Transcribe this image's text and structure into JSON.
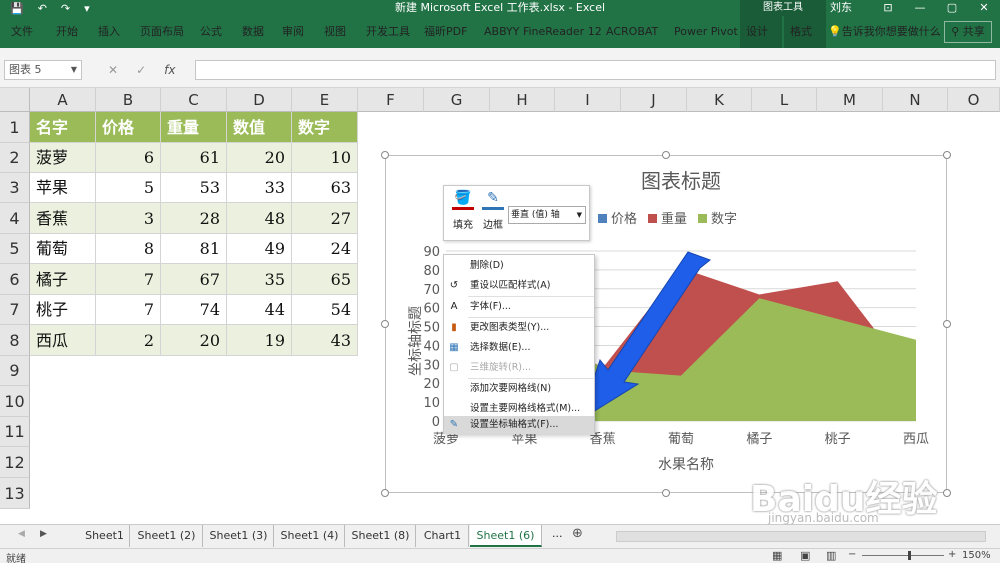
{
  "window": {
    "title": "新建 Microsoft Excel 工作表.xlsx  -  Excel",
    "context_group": "图表工具",
    "user": "刘东",
    "controls": [
      "—",
      "▢",
      "✕"
    ]
  },
  "ribbon": {
    "tabs": [
      "文件",
      "开始",
      "插入",
      "页面布局",
      "公式",
      "数据",
      "审阅",
      "视图",
      "开发工具",
      "福昕PDF",
      "ABBYY FineReader 12",
      "ACROBAT",
      "Power Pivot",
      "设计",
      "格式"
    ],
    "tell_me": "告诉我你想要做什么",
    "share": "共享"
  },
  "formula_bar": {
    "name_box": "图表 5",
    "cancel": "✕",
    "enter": "✓",
    "fx": "fx",
    "value": ""
  },
  "columns": [
    "A",
    "B",
    "C",
    "D",
    "E",
    "F",
    "G",
    "H",
    "I",
    "J",
    "K",
    "L",
    "M",
    "N",
    "O"
  ],
  "rows": [
    "1",
    "2",
    "3",
    "4",
    "5",
    "6",
    "7",
    "8",
    "9",
    "10",
    "11",
    "12",
    "13"
  ],
  "table": {
    "headers": [
      "名字",
      "价格",
      "重量",
      "数值",
      "数字"
    ],
    "rows": [
      [
        "菠萝",
        "6",
        "61",
        "20",
        "10"
      ],
      [
        "苹果",
        "5",
        "53",
        "33",
        "63"
      ],
      [
        "香蕉",
        "3",
        "28",
        "48",
        "27"
      ],
      [
        "葡萄",
        "8",
        "81",
        "49",
        "24"
      ],
      [
        "橘子",
        "7",
        "67",
        "35",
        "65"
      ],
      [
        "桃子",
        "7",
        "74",
        "44",
        "54"
      ],
      [
        "西瓜",
        "2",
        "20",
        "19",
        "43"
      ]
    ]
  },
  "chart_data": {
    "type": "area",
    "title": "图表标题",
    "xlabel": "水果名称",
    "ylabel": "坐标轴标题",
    "categories": [
      "菠萝",
      "苹果",
      "香蕉",
      "葡萄",
      "橘子",
      "桃子",
      "西瓜"
    ],
    "series": [
      {
        "name": "价格",
        "color": "#4f81bd",
        "values": [
          6,
          5,
          3,
          8,
          7,
          7,
          2
        ]
      },
      {
        "name": "重量",
        "color": "#c0504d",
        "values": [
          61,
          53,
          28,
          81,
          67,
          74,
          20
        ]
      },
      {
        "name": "数字",
        "color": "#9bbb59",
        "values": [
          10,
          63,
          27,
          24,
          65,
          54,
          43
        ]
      }
    ],
    "y_ticks": [
      "0",
      "10",
      "20",
      "30",
      "40",
      "50",
      "60",
      "70",
      "80",
      "90"
    ],
    "ylim": [
      0,
      90
    ],
    "legend_position": "top",
    "grid": true
  },
  "mini_toolbar": {
    "fill_label": "填充",
    "outline_label": "边框",
    "element_select": "垂直 (值) 轴"
  },
  "context_menu": {
    "items": [
      {
        "label": "删除(D)",
        "icon": "",
        "disabled": false
      },
      {
        "label": "重设以匹配样式(A)",
        "icon": "reset-icon",
        "disabled": false
      },
      {
        "label": "字体(F)...",
        "icon": "font-icon",
        "disabled": false
      },
      {
        "label": "更改图表类型(Y)...",
        "icon": "chart-type-icon",
        "disabled": false
      },
      {
        "label": "选择数据(E)...",
        "icon": "select-data-icon",
        "disabled": false
      },
      {
        "label": "三维旋转(R)...",
        "icon": "3d-rotate-icon",
        "disabled": true
      },
      {
        "label": "添加次要网格线(N)",
        "icon": "",
        "disabled": false
      },
      {
        "label": "设置主要网格线格式(M)...",
        "icon": "",
        "disabled": false
      },
      {
        "label": "设置坐标轴格式(F)...",
        "icon": "format-axis-icon",
        "disabled": false
      }
    ]
  },
  "sheet_tabs": {
    "tabs": [
      "Sheet1",
      "Sheet1 (2)",
      "Sheet1 (3)",
      "Sheet1 (4)",
      "Sheet1 (8)",
      "Chart1",
      "Sheet1 (6)"
    ],
    "active": "Sheet1 (6)",
    "more": "...",
    "add": "⊕"
  },
  "status_bar": {
    "mode": "就绪",
    "zoom": "150%",
    "zoom_out": "−",
    "zoom_in": "+"
  },
  "watermark": {
    "text": "Baidu经验",
    "url": "jingyan.baidu.com"
  }
}
